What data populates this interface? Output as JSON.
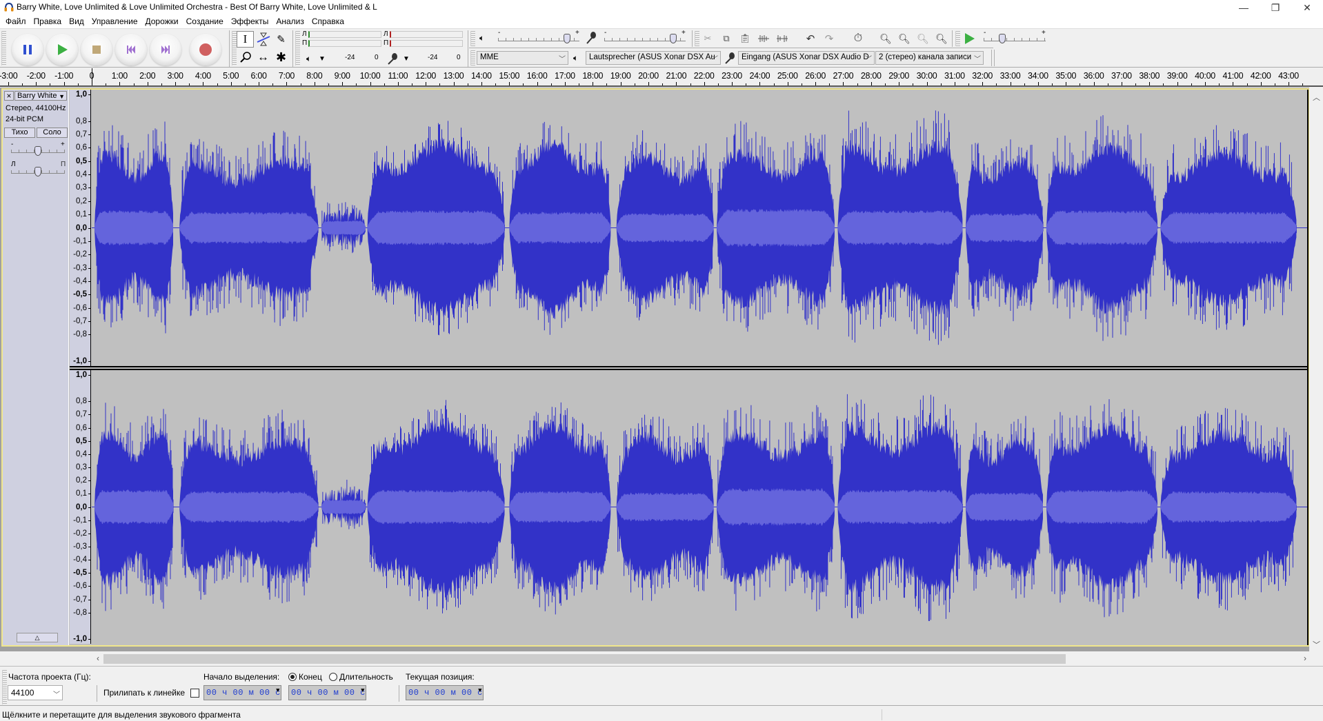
{
  "window": {
    "title": "Barry White, Love Unlimited & Love Unlimited Orchestra - Best Of Barry White, Love Unlimited & L",
    "controls": {
      "minimize": "—",
      "maximize": "❐",
      "close": "✕"
    }
  },
  "menu": [
    "Файл",
    "Правка",
    "Вид",
    "Управление",
    "Дорожки",
    "Создание",
    "Эффекты",
    "Анализ",
    "Справка"
  ],
  "transport": {
    "buttons": [
      {
        "name": "pause-button",
        "icon": "pause-icon",
        "color": "#3050d0"
      },
      {
        "name": "play-button",
        "icon": "play-icon",
        "color": "#3cb043"
      },
      {
        "name": "stop-button",
        "icon": "stop-icon",
        "color": "#c0a878"
      },
      {
        "name": "skip-start-button",
        "icon": "skip-start-icon",
        "color": "#a070d0"
      },
      {
        "name": "skip-end-button",
        "icon": "skip-end-icon",
        "color": "#a070d0"
      },
      {
        "name": "record-button",
        "icon": "record-icon",
        "color": "#d06060"
      }
    ]
  },
  "tools": {
    "selection": "I",
    "envelope": "envelope",
    "draw": "✎",
    "zoom": "⚲",
    "timeshift": "↔",
    "multi": "✱"
  },
  "meters": {
    "playback": {
      "left_label": "Л",
      "right_label": "П",
      "scale": [
        "-24",
        "0"
      ]
    },
    "record": {
      "left_label": "Л",
      "right_label": "П",
      "scale": [
        "-24",
        "0"
      ]
    }
  },
  "mixer": {
    "playback_volume": 0.85,
    "record_volume": 0.85,
    "minus": "-",
    "plus": "+"
  },
  "device": {
    "host": "MME",
    "output": "Lautsprecher (ASUS Xonar DSX Au",
    "input": "Eingang (ASUS Xonar DSX Audio D",
    "channels": "2 (стерео) канала записи"
  },
  "play_at_speed": {
    "minus": "-",
    "plus": "+",
    "speed": 0.3
  },
  "ruler": {
    "labels": [
      "-3:00",
      "-2:00",
      "-1:00",
      "0",
      "1:00",
      "2:00",
      "3:00",
      "4:00",
      "5:00",
      "6:00",
      "7:00",
      "8:00",
      "9:00",
      "10:00",
      "11:00",
      "12:00",
      "13:00",
      "14:00",
      "15:00",
      "16:00",
      "17:00",
      "18:00",
      "19:00",
      "20:00",
      "21:00",
      "22:00",
      "23:00",
      "24:00",
      "25:00",
      "26:00",
      "27:00",
      "28:00",
      "29:00",
      "30:00",
      "31:00",
      "32:00",
      "33:00",
      "34:00",
      "35:00",
      "36:00",
      "37:00",
      "38:00",
      "39:00",
      "40:00",
      "41:00",
      "42:00",
      "43:00"
    ],
    "start_min": -3,
    "end_min": 43
  },
  "track": {
    "name": "Barry White",
    "info_format": "Стерео, 44100Hz",
    "info_bits": "24-bit PCM",
    "mute": "Тихо",
    "solo": "Соло",
    "gain_minus": "-",
    "gain_plus": "+",
    "pan_left": "Л",
    "pan_right": "П",
    "gain": 0.5,
    "pan": 0.5,
    "collapse": "△",
    "vruler_labels": [
      {
        "v": "1,0",
        "val": 1.0,
        "bold": true
      },
      {
        "v": "0,8",
        "val": 0.8
      },
      {
        "v": "0,7",
        "val": 0.7
      },
      {
        "v": "0,6",
        "val": 0.6
      },
      {
        "v": "0,5",
        "val": 0.5,
        "bold": true
      },
      {
        "v": "0,4",
        "val": 0.4
      },
      {
        "v": "0,3",
        "val": 0.3
      },
      {
        "v": "0,2",
        "val": 0.2
      },
      {
        "v": "0,1",
        "val": 0.1
      },
      {
        "v": "0,0",
        "val": 0.0,
        "bold": true
      },
      {
        "v": "-0,1",
        "val": -0.1
      },
      {
        "v": "-0,2",
        "val": -0.2
      },
      {
        "v": "-0,3",
        "val": -0.3
      },
      {
        "v": "-0,4",
        "val": -0.4
      },
      {
        "v": "-0,5",
        "val": -0.5,
        "bold": true
      },
      {
        "v": "-0,6",
        "val": -0.6
      },
      {
        "v": "-0,7",
        "val": -0.7
      },
      {
        "v": "-0,8",
        "val": -0.8
      },
      {
        "v": "-1,0",
        "val": -1.0,
        "bold": true
      }
    ],
    "wave_color": "#3232c8",
    "rms_color": "#6464dc",
    "segments": [
      {
        "start": 0.1,
        "end": 2.95,
        "peak": 0.78,
        "body": 0.55,
        "rms": 0.12
      },
      {
        "start": 3.15,
        "end": 8.15,
        "peak": 0.72,
        "body": 0.5,
        "rms": 0.11
      },
      {
        "start": 8.25,
        "end": 9.85,
        "peak": 0.2,
        "body": 0.1,
        "rms": 0.05
      },
      {
        "start": 9.9,
        "end": 14.85,
        "peak": 0.8,
        "body": 0.62,
        "rms": 0.12
      },
      {
        "start": 15.0,
        "end": 18.65,
        "peak": 0.8,
        "body": 0.62,
        "rms": 0.11
      },
      {
        "start": 18.85,
        "end": 22.35,
        "peak": 0.72,
        "body": 0.52,
        "rms": 0.1
      },
      {
        "start": 22.45,
        "end": 26.7,
        "peak": 0.78,
        "body": 0.55,
        "rms": 0.13
      },
      {
        "start": 26.8,
        "end": 31.3,
        "peak": 0.86,
        "body": 0.6,
        "rms": 0.12
      },
      {
        "start": 31.4,
        "end": 34.2,
        "peak": 0.7,
        "body": 0.5,
        "rms": 0.1
      },
      {
        "start": 34.3,
        "end": 38.3,
        "peak": 0.85,
        "body": 0.6,
        "rms": 0.12
      },
      {
        "start": 38.4,
        "end": 43.3,
        "peak": 0.78,
        "body": 0.55,
        "rms": 0.11
      }
    ]
  },
  "selection_bar": {
    "rate_label": "Частота проекта (Гц):",
    "rate_value": "44100",
    "snap_label": "Прилипать к линейке",
    "snap_checked": false,
    "start_label": "Начало выделения:",
    "end_option": "Конец",
    "length_option": "Длительность",
    "end_selected": true,
    "position_label": "Текущая позиция:",
    "start_time": "00 ч 00 м 00 с",
    "end_time": "00 ч 00 м 00 с",
    "position_time": "00 ч 00 м 00 с"
  },
  "status": {
    "text": "Щёлкните и перетащите для выделения звукового фрагмента"
  }
}
